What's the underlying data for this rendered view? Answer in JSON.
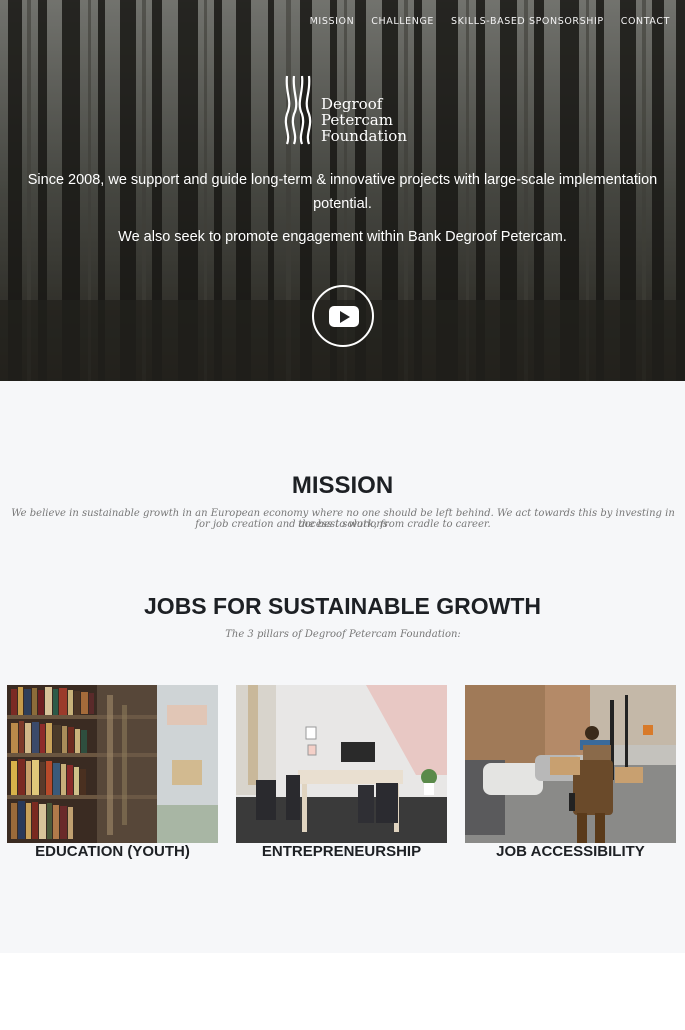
{
  "nav": {
    "items": [
      "MISSION",
      "CHALLENGE",
      "SKILLS-BASED SPONSORSHIP",
      "CONTACT"
    ]
  },
  "logo": {
    "lines": [
      "Degroof",
      "Petercam",
      "Foundation"
    ]
  },
  "hero": {
    "line1": "Since 2008, we support and guide long-term & innovative projects with large-scale implementation potential.",
    "line2": "We also seek to promote engagement within Bank Degroof Petercam."
  },
  "mission": {
    "title": "MISSION",
    "text_line1": "We believe in sustainable growth in an European economy where no one should be left behind. We act towards this by investing in the best solutions",
    "text_line2": "for job creation and access to work, from cradle to career."
  },
  "growth": {
    "title": "JOBS FOR SUSTAINABLE GROWTH",
    "subtitle": "The 3 pillars of Degroof Petercam Foundation:"
  },
  "pillars": [
    {
      "label": "EDUCATION (YOUTH)"
    },
    {
      "label": "ENTREPRENEURSHIP"
    },
    {
      "label": "JOB ACCESSIBILITY"
    }
  ],
  "icons": [
    "youtube-play-icon",
    "foundation-logo-mark"
  ]
}
